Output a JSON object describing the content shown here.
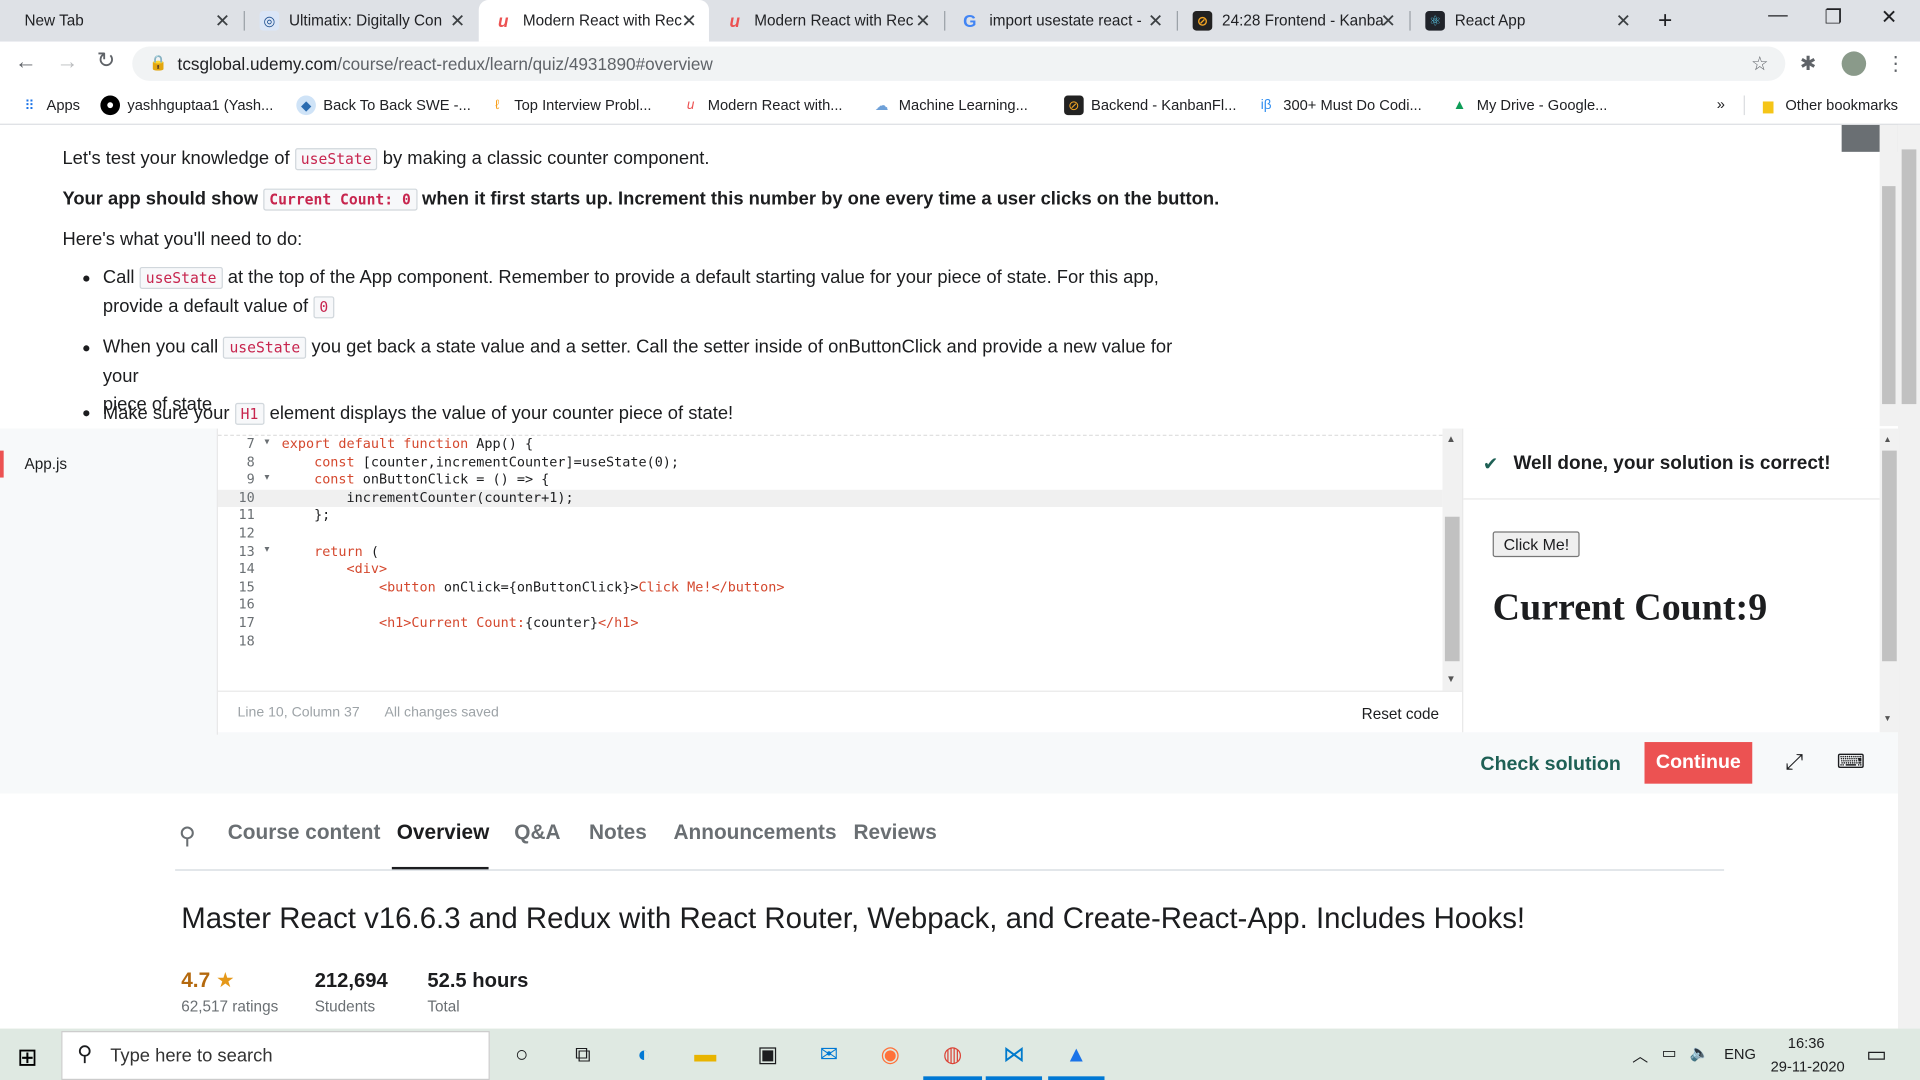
{
  "tabs": [
    {
      "title": "New Tab",
      "active": false
    },
    {
      "title": "Ultimatix: Digitally Con",
      "active": false
    },
    {
      "title": "Modern React with Rec",
      "active": true
    },
    {
      "title": "Modern React with Rec",
      "active": false
    },
    {
      "title": "import usestate react -",
      "active": false
    },
    {
      "title": "24:28 Frontend - Kanba",
      "active": false
    },
    {
      "title": "React App",
      "active": false
    }
  ],
  "new_tab": "+",
  "url": {
    "host": "tcsglobal.udemy.com",
    "path": "/course/react-redux/learn/quiz/4931890#overview"
  },
  "bookmarks": [
    "Apps",
    "yashhguptaa1 (Yash...",
    "Back To Back SWE -...",
    "Top Interview Probl...",
    "Modern React with...",
    "Machine Learning...",
    "Backend - KanbanFl...",
    "300+ Must Do Codi...",
    "My Drive - Google..."
  ],
  "bookmarks_more": "»",
  "other_bookmarks": "Other bookmarks",
  "quiz": {
    "intro_a": "Let's test your knowledge of",
    "intro_code": "useState",
    "intro_b": "by making a classic counter component.",
    "bold_a": "Your app should show",
    "bold_code": "Current Count: 0",
    "bold_b": "when it first starts up.  Increment this number by one every time a user clicks on the button.",
    "todo": "Here's what you'll need to do:",
    "b1_a": "Call",
    "b1_code": "useState",
    "b1_b": "at the top of the App component.  Remember to provide a default starting value for your piece of state.  For this app,",
    "b1_c": "provide a default value of",
    "b1_code2": "0",
    "b2_a": "When you call",
    "b2_code": "useState",
    "b2_b": "you get back a state value and a setter.  Call the setter inside of onButtonClick and provide a new value for your",
    "b2_c": "piece of state",
    "b3_a": "Make sure your",
    "b3_code": "H1",
    "b3_b": "element displays the value of your counter piece of state!"
  },
  "file": "App.js",
  "code_lines": [
    {
      "n": "7",
      "fold": "▾",
      "t": "export default function App() {"
    },
    {
      "n": "8",
      "fold": "",
      "t": "    const [counter,incrementCounter]=useState(0);"
    },
    {
      "n": "9",
      "fold": "▾",
      "t": "    const onButtonClick = () => {"
    },
    {
      "n": "10",
      "fold": "",
      "t": "        incrementCounter(counter+1);"
    },
    {
      "n": "11",
      "fold": "",
      "t": "    };"
    },
    {
      "n": "12",
      "fold": "",
      "t": ""
    },
    {
      "n": "13",
      "fold": "▾",
      "t": "    return ("
    },
    {
      "n": "14",
      "fold": "",
      "t": "        <div>"
    },
    {
      "n": "15",
      "fold": "",
      "t": "            <button onClick={onButtonClick}>Click Me!</button>"
    },
    {
      "n": "16",
      "fold": "",
      "t": ""
    },
    {
      "n": "17",
      "fold": "",
      "t": "            <h1>Current Count:{counter}</h1>"
    },
    {
      "n": "18",
      "fold": "",
      "t": ""
    }
  ],
  "status": {
    "position": "Line 10, Column 37",
    "saved": "All changes saved",
    "reset": "Reset code"
  },
  "result": {
    "message": "Well done, your solution is correct!",
    "button": "Click Me!",
    "heading": "Current Count:9"
  },
  "actions": {
    "check": "Check solution",
    "continue": "Continue"
  },
  "course_tabs": [
    "Course content",
    "Overview",
    "Q&A",
    "Notes",
    "Announcements",
    "Reviews"
  ],
  "active_course_tab": "Overview",
  "course_title": "Master React v16.6.3 and Redux with React Router, Webpack, and Create-React-App. Includes Hooks!",
  "stats": {
    "rating": "4.7",
    "ratings": "62,517 ratings",
    "students": "212,694",
    "students_label": "Students",
    "hours": "52.5 hours",
    "hours_label": "Total"
  },
  "taskbar": {
    "search": "Type here to search",
    "lang": "ENG",
    "time": "16:36",
    "date": "29-11-2020"
  },
  "colors": {
    "accent": "#1e6055",
    "red": "#ec5252",
    "orange": "#b4690e",
    "green": "#1e6055"
  }
}
